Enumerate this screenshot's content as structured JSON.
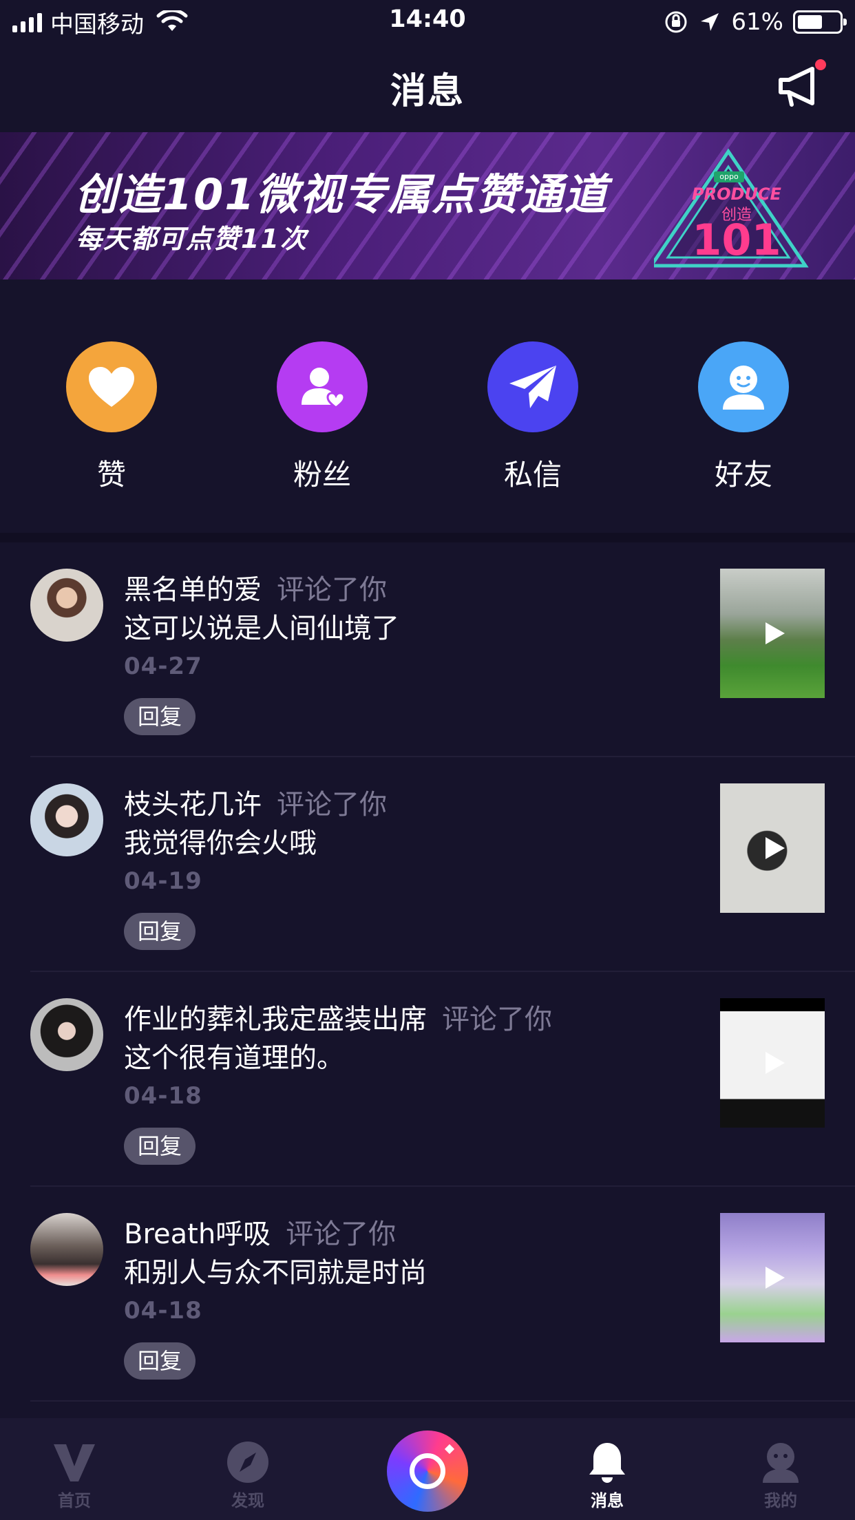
{
  "status_bar": {
    "carrier": "中国移动",
    "time": "14:40",
    "battery_percent": "61%",
    "battery_level": 0.61
  },
  "header": {
    "title": "消息",
    "announce_icon": "megaphone-icon",
    "has_notification_dot": true
  },
  "banner": {
    "title": "创造101微视专属点赞通道",
    "subtitle": "每天都可点赞11次",
    "logo": {
      "brand": "oppo",
      "produce": "PRODUCE",
      "chuangzao": "创造",
      "number": "101"
    }
  },
  "quick_actions": [
    {
      "label": "赞",
      "icon": "heart-icon",
      "color": "#f4a53c"
    },
    {
      "label": "粉丝",
      "icon": "fan-icon",
      "color": "#b53cf2"
    },
    {
      "label": "私信",
      "icon": "paper-plane-icon",
      "color": "#4b43f0"
    },
    {
      "label": "好友",
      "icon": "friend-icon",
      "color": "#4aa6f7"
    }
  ],
  "notifications": [
    {
      "user": "黑名单的爱",
      "action": "评论了你",
      "comment": "这可以说是人间仙境了",
      "date": "04-27",
      "reply": "回复"
    },
    {
      "user": "枝头花几许",
      "action": "评论了你",
      "comment": "我觉得你会火哦",
      "date": "04-19",
      "reply": "回复"
    },
    {
      "user": "作业的葬礼我定盛装出席",
      "action": "评论了你",
      "comment": "这个很有道理的。",
      "date": "04-18",
      "reply": "回复"
    },
    {
      "user": "Breath呼吸",
      "action": "评论了你",
      "comment": "和别人与众不同就是时尚",
      "date": "04-18",
      "reply": "回复"
    }
  ],
  "tab_bar": {
    "tabs": [
      {
        "label": "首页",
        "icon": "v-logo-icon"
      },
      {
        "label": "发现",
        "icon": "compass-icon"
      },
      {
        "label": "消息",
        "icon": "bell-icon",
        "active": true
      },
      {
        "label": "我的",
        "icon": "profile-icon"
      }
    ],
    "center_icon": "record-camera-icon"
  }
}
